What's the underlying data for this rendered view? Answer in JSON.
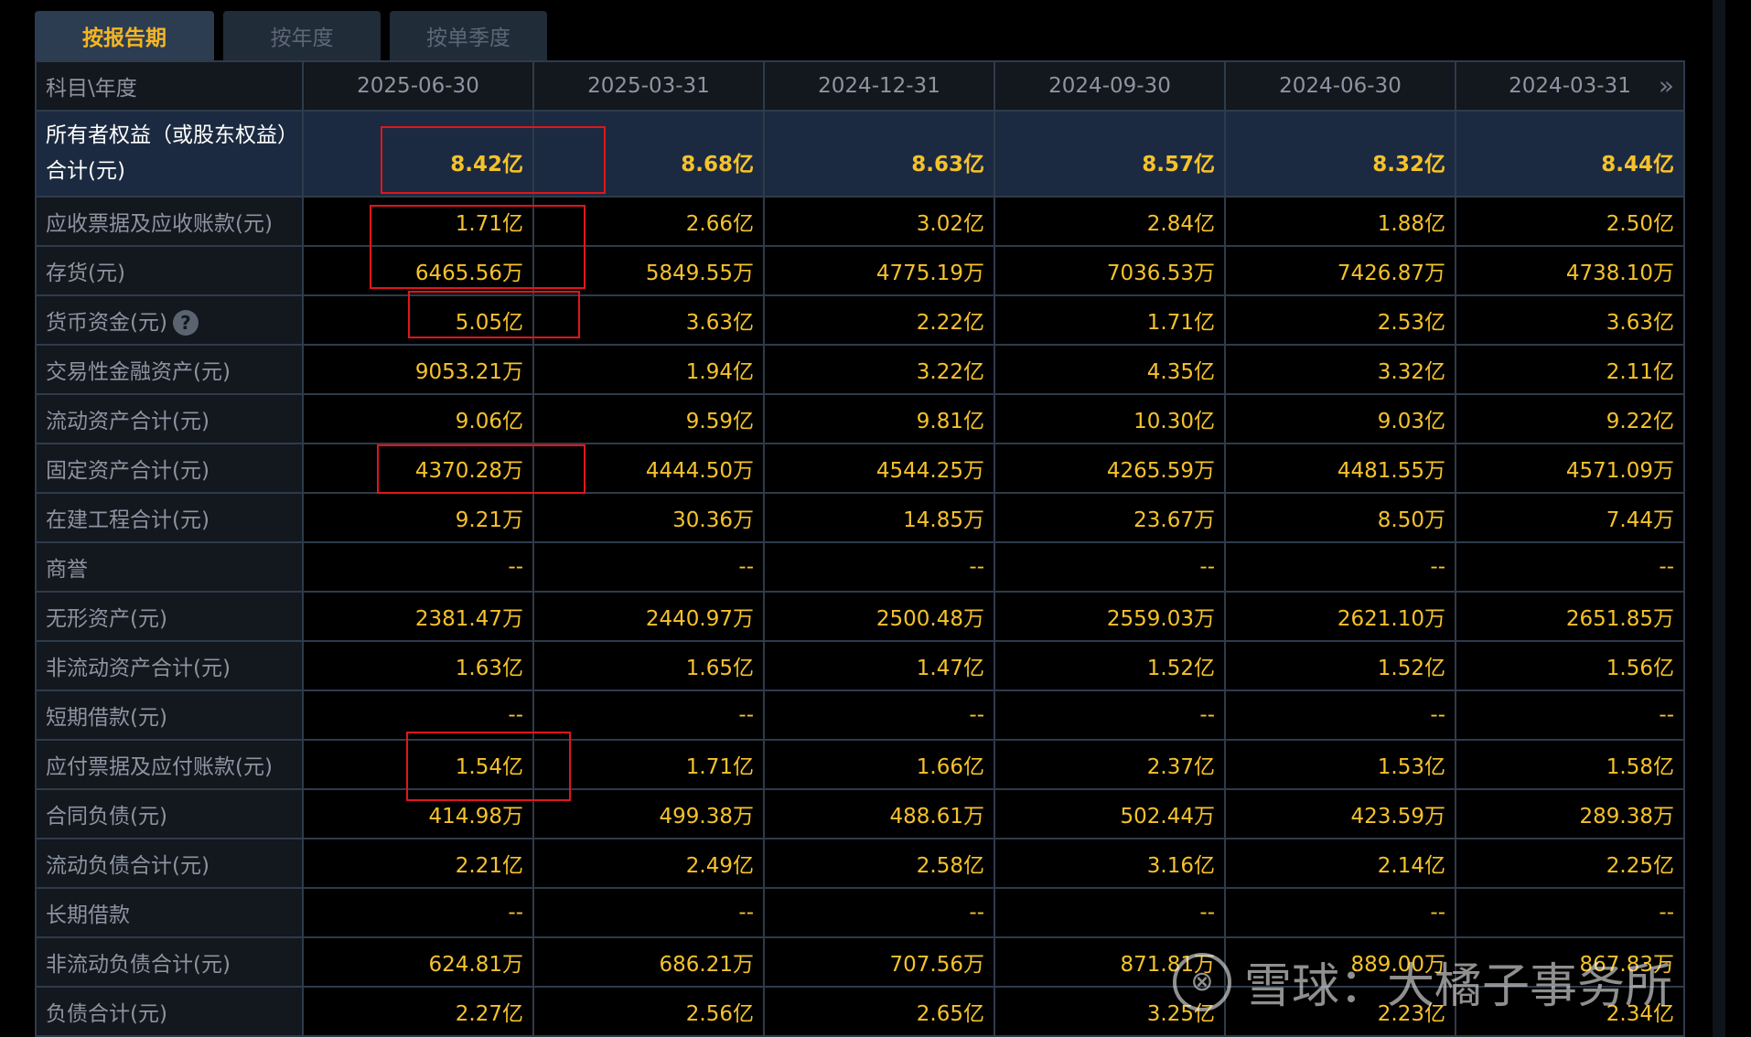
{
  "tabs": [
    "按报告期",
    "按年度",
    "按单季度"
  ],
  "header": {
    "first": "科目\\年度",
    "dates": [
      "2025-06-30",
      "2025-03-31",
      "2024-12-31",
      "2024-09-30",
      "2024-06-30",
      "2024-03-31"
    ],
    "next_icon": "»"
  },
  "rows": [
    {
      "label": "所有者权益（或股东权益）合计(元)",
      "values": [
        "8.42亿",
        "8.68亿",
        "8.63亿",
        "8.57亿",
        "8.32亿",
        "8.44亿"
      ]
    },
    {
      "label": "应收票据及应收账款(元)",
      "values": [
        "1.71亿",
        "2.66亿",
        "3.02亿",
        "2.84亿",
        "1.88亿",
        "2.50亿"
      ]
    },
    {
      "label": "存货(元)",
      "values": [
        "6465.56万",
        "5849.55万",
        "4775.19万",
        "7036.53万",
        "7426.87万",
        "4738.10万"
      ]
    },
    {
      "label": "货币资金(元)",
      "values": [
        "5.05亿",
        "3.63亿",
        "2.22亿",
        "1.71亿",
        "2.53亿",
        "3.63亿"
      ]
    },
    {
      "label": "交易性金融资产(元)",
      "values": [
        "9053.21万",
        "1.94亿",
        "3.22亿",
        "4.35亿",
        "3.32亿",
        "2.11亿"
      ]
    },
    {
      "label": "流动资产合计(元)",
      "values": [
        "9.06亿",
        "9.59亿",
        "9.81亿",
        "10.30亿",
        "9.03亿",
        "9.22亿"
      ]
    },
    {
      "label": "固定资产合计(元)",
      "values": [
        "4370.28万",
        "4444.50万",
        "4544.25万",
        "4265.59万",
        "4481.55万",
        "4571.09万"
      ]
    },
    {
      "label": "在建工程合计(元)",
      "values": [
        "9.21万",
        "30.36万",
        "14.85万",
        "23.67万",
        "8.50万",
        "7.44万"
      ]
    },
    {
      "label": "商誉",
      "values": [
        "--",
        "--",
        "--",
        "--",
        "--",
        "--"
      ]
    },
    {
      "label": "无形资产(元)",
      "values": [
        "2381.47万",
        "2440.97万",
        "2500.48万",
        "2559.03万",
        "2621.10万",
        "2651.85万"
      ]
    },
    {
      "label": "非流动资产合计(元)",
      "values": [
        "1.63亿",
        "1.65亿",
        "1.47亿",
        "1.52亿",
        "1.52亿",
        "1.56亿"
      ]
    },
    {
      "label": "短期借款(元)",
      "values": [
        "--",
        "--",
        "--",
        "--",
        "--",
        "--"
      ]
    },
    {
      "label": "应付票据及应付账款(元)",
      "values": [
        "1.54亿",
        "1.71亿",
        "1.66亿",
        "2.37亿",
        "1.53亿",
        "1.58亿"
      ]
    },
    {
      "label": "合同负债(元)",
      "values": [
        "414.98万",
        "499.38万",
        "488.61万",
        "502.44万",
        "423.59万",
        "289.38万"
      ]
    },
    {
      "label": "流动负债合计(元)",
      "values": [
        "2.21亿",
        "2.49亿",
        "2.58亿",
        "3.16亿",
        "2.14亿",
        "2.25亿"
      ]
    },
    {
      "label": "长期借款",
      "values": [
        "--",
        "--",
        "--",
        "--",
        "--",
        "--"
      ]
    },
    {
      "label": "非流动负债合计(元)",
      "values": [
        "624.81万",
        "686.21万",
        "707.56万",
        "871.81万",
        "889.00万",
        "867.83万"
      ]
    },
    {
      "label": "负债合计(元)",
      "values": [
        "2.27亿",
        "2.56亿",
        "2.65亿",
        "3.25亿",
        "2.23亿",
        "2.34亿"
      ]
    }
  ],
  "help_icon_glyph": "?",
  "watermark": {
    "logo_glyph": "⊗",
    "text": "雪球：大橘子事务所"
  },
  "colors": {
    "value": "#f6c22b",
    "label": "#8b94a0",
    "highlight_row": "#1b2a40",
    "annotation_box": "#e0161c",
    "active_tab": "#f5b521"
  }
}
